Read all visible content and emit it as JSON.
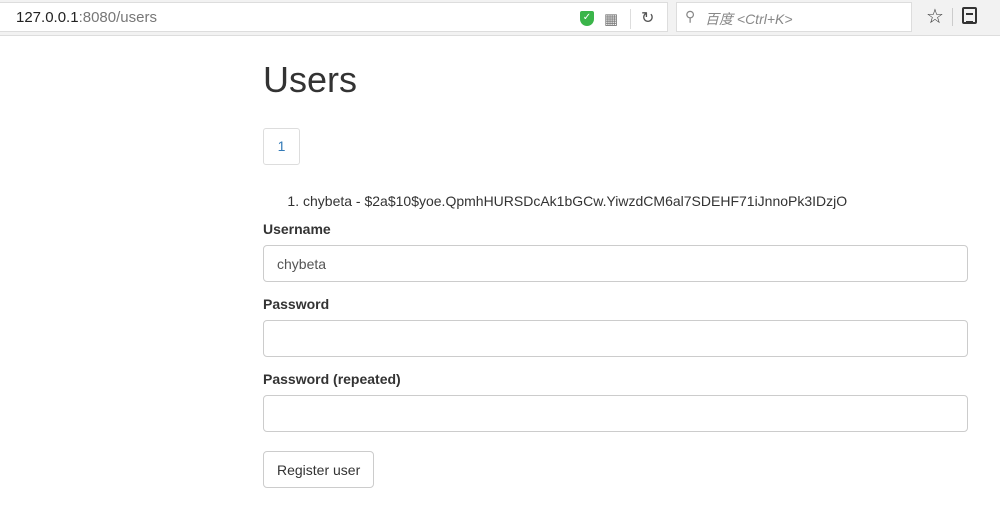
{
  "browser": {
    "url_host": "127.0.0.1",
    "url_rest": ":8080/users",
    "search_placeholder": "百度 <Ctrl+K>"
  },
  "page": {
    "title": "Users",
    "pagination": [
      "1"
    ],
    "users": [
      {
        "text": "chybeta - $2a$10$yoe.QpmhHURSDcAk1bGCw.YiwzdCM6al7SDEHF71iJnnoPk3IDzjO"
      }
    ],
    "form": {
      "username_label": "Username",
      "username_value": "chybeta",
      "password_label": "Password",
      "password2_label": "Password (repeated)",
      "submit": "Register user"
    }
  }
}
